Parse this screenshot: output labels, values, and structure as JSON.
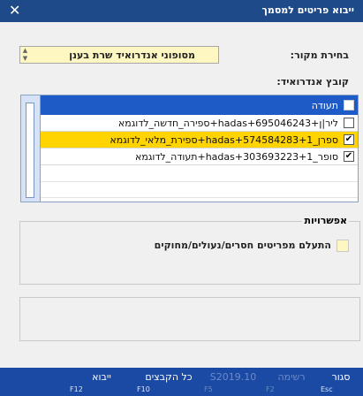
{
  "window": {
    "title": "ייבוא פריטים למסמך"
  },
  "source": {
    "label": "בחירת מקור:",
    "value": "מסופוני אנדרואיד שרת בענן"
  },
  "files": {
    "label": "קובץ אנדרואיד:",
    "header": "תעודה",
    "rows": [
      {
        "text": "ליר|ן+695046243+hadas+ספירה_חדשה_לדוגמא",
        "checked": false
      },
      {
        "text": "ספרן_574584283+1+hadas+ספירת_מלאי_לדוגמא",
        "checked": true
      },
      {
        "text": "סופר_303693223+1+hadas+תעודה_לדוגמא",
        "checked": true
      }
    ]
  },
  "options": {
    "title": "אפשרויות",
    "ignore_label": "התעלם מפריטים חסרים/נעולים/מחוקים"
  },
  "toolbar": [
    {
      "label": "סגור",
      "key": "Esc",
      "enabled": true
    },
    {
      "label": "רשימה",
      "key": "F2",
      "enabled": false
    },
    {
      "label": "S2019.10",
      "key": "F5",
      "enabled": false
    },
    {
      "label": "כל הקבצים",
      "key": "F10",
      "enabled": true
    },
    {
      "label": "ייבוא",
      "key": "F12",
      "enabled": true
    }
  ]
}
